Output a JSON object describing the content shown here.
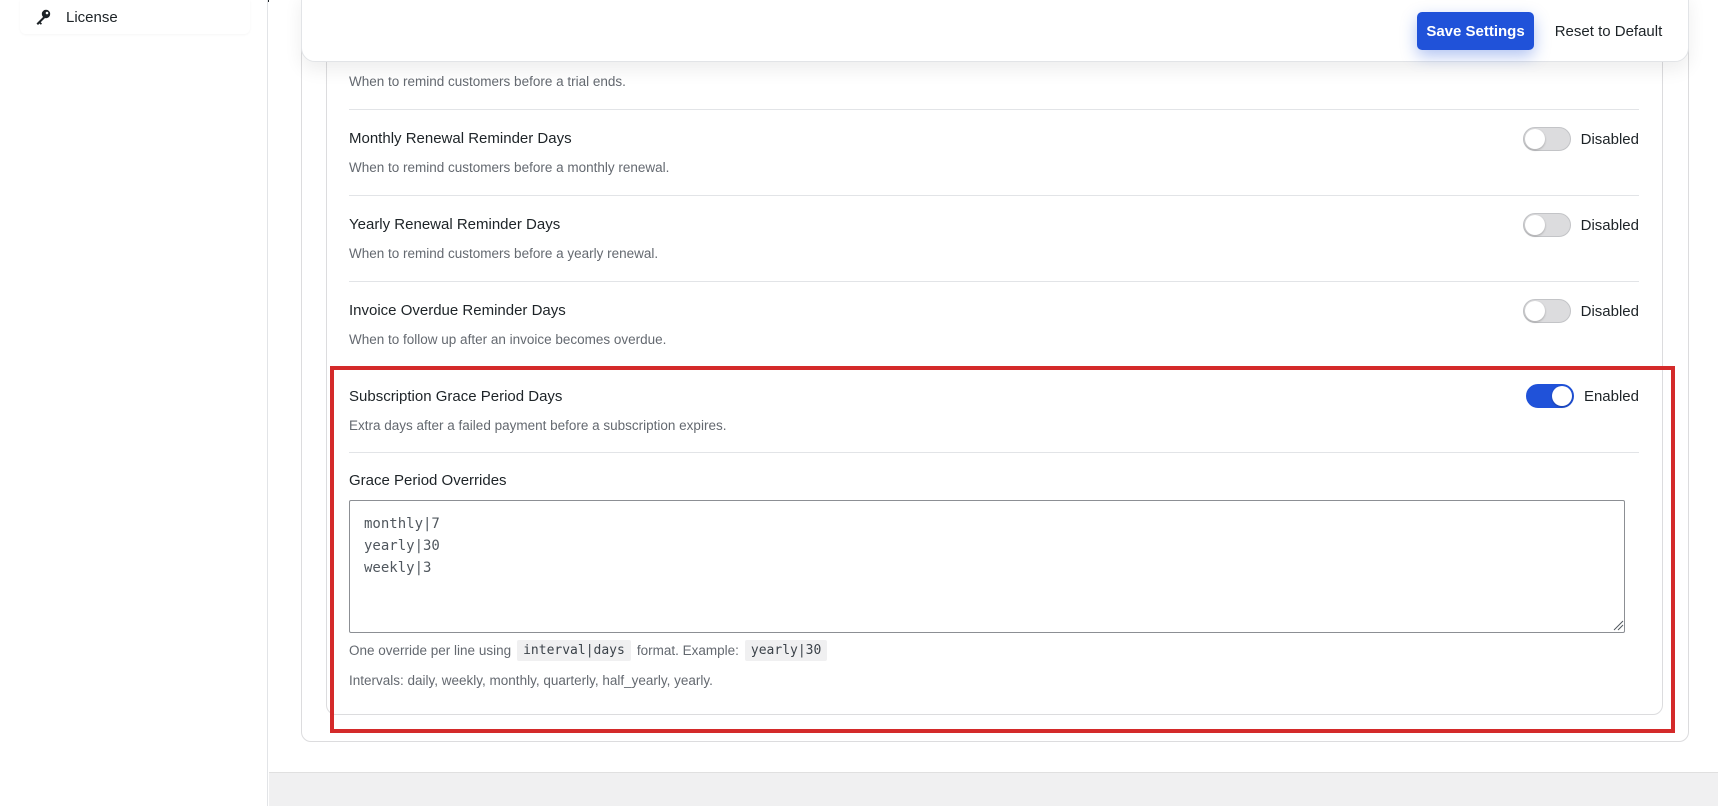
{
  "sidebar": {
    "items": [
      {
        "label": "License",
        "icon": "key-icon"
      }
    ]
  },
  "toolbar": {
    "save_label": "Save Settings",
    "reset_label": "Reset to Default"
  },
  "settings": {
    "trial": {
      "desc": "When to remind customers before a trial ends."
    },
    "monthly": {
      "title": "Monthly Renewal Reminder Days",
      "desc": "When to remind customers before a monthly renewal.",
      "state": "Disabled",
      "enabled": false
    },
    "yearly": {
      "title": "Yearly Renewal Reminder Days",
      "desc": "When to remind customers before a yearly renewal.",
      "state": "Disabled",
      "enabled": false
    },
    "invoice": {
      "title": "Invoice Overdue Reminder Days",
      "desc": "When to follow up after an invoice becomes overdue.",
      "state": "Disabled",
      "enabled": false
    },
    "grace": {
      "title": "Subscription Grace Period Days",
      "desc": "Extra days after a failed payment before a subscription expires.",
      "state": "Enabled",
      "enabled": true
    },
    "overrides": {
      "title": "Grace Period Overrides",
      "value": "monthly|7\nyearly|30\nweekly|3",
      "help_prefix": "One override per line using",
      "help_code1": "interval|days",
      "help_middle": "format. Example:",
      "help_code2": "yearly|30",
      "intervals": "Intervals: daily, weekly, monthly, quarterly, half_yearly, yearly."
    }
  },
  "colors": {
    "accent": "#2052d9",
    "highlight": "#d42a2a",
    "toggle_off": "#dcdcde"
  }
}
